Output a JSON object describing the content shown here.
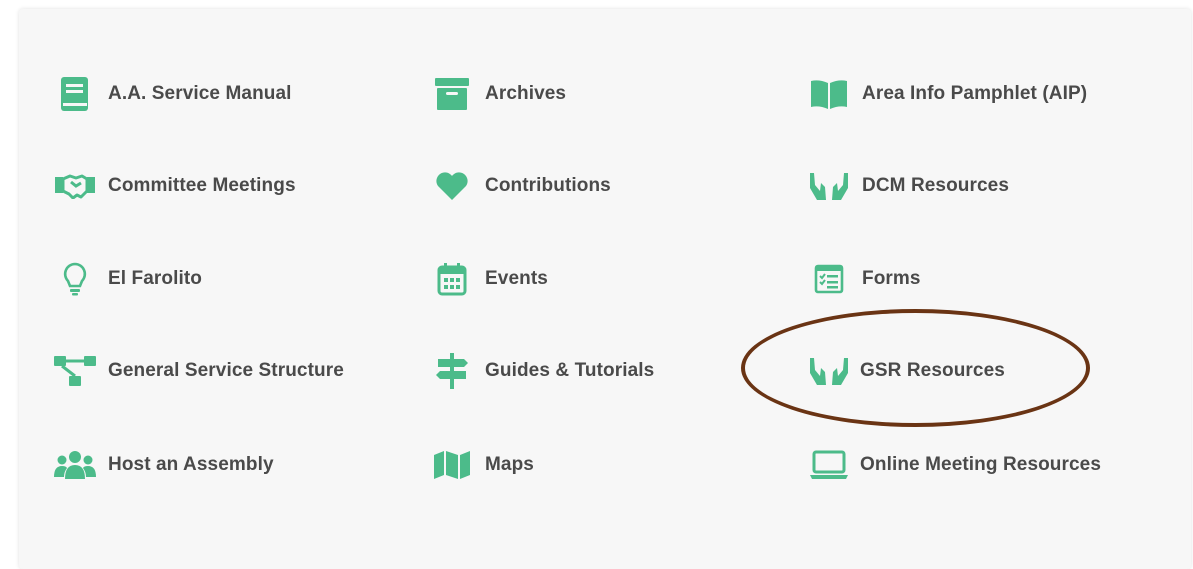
{
  "theme": {
    "icon_color": "#4cbb8a",
    "text_color": "#4a4a4a",
    "highlight_color": "#6a3414"
  },
  "links": [
    {
      "label": "A.A. Service Manual",
      "icon": "book-icon"
    },
    {
      "label": "Archives",
      "icon": "archive-box-icon"
    },
    {
      "label": "Area Info Pamphlet (AIP)",
      "icon": "open-book-icon"
    },
    {
      "label": "Committee Meetings",
      "icon": "handshake-icon"
    },
    {
      "label": "Contributions",
      "icon": "heart-icon"
    },
    {
      "label": "DCM Resources",
      "icon": "hands-icon"
    },
    {
      "label": "El Farolito",
      "icon": "lightbulb-icon"
    },
    {
      "label": "Events",
      "icon": "calendar-icon"
    },
    {
      "label": "Forms",
      "icon": "form-icon"
    },
    {
      "label": "General Service Structure",
      "icon": "sitemap-icon"
    },
    {
      "label": "Guides & Tutorials",
      "icon": "signpost-icon"
    },
    {
      "label": "GSR Resources",
      "icon": "hands-icon"
    },
    {
      "label": "Host an Assembly",
      "icon": "users-icon"
    },
    {
      "label": "Maps",
      "icon": "map-icon"
    },
    {
      "label": "Online Meeting Resources",
      "icon": "laptop-icon"
    }
  ]
}
